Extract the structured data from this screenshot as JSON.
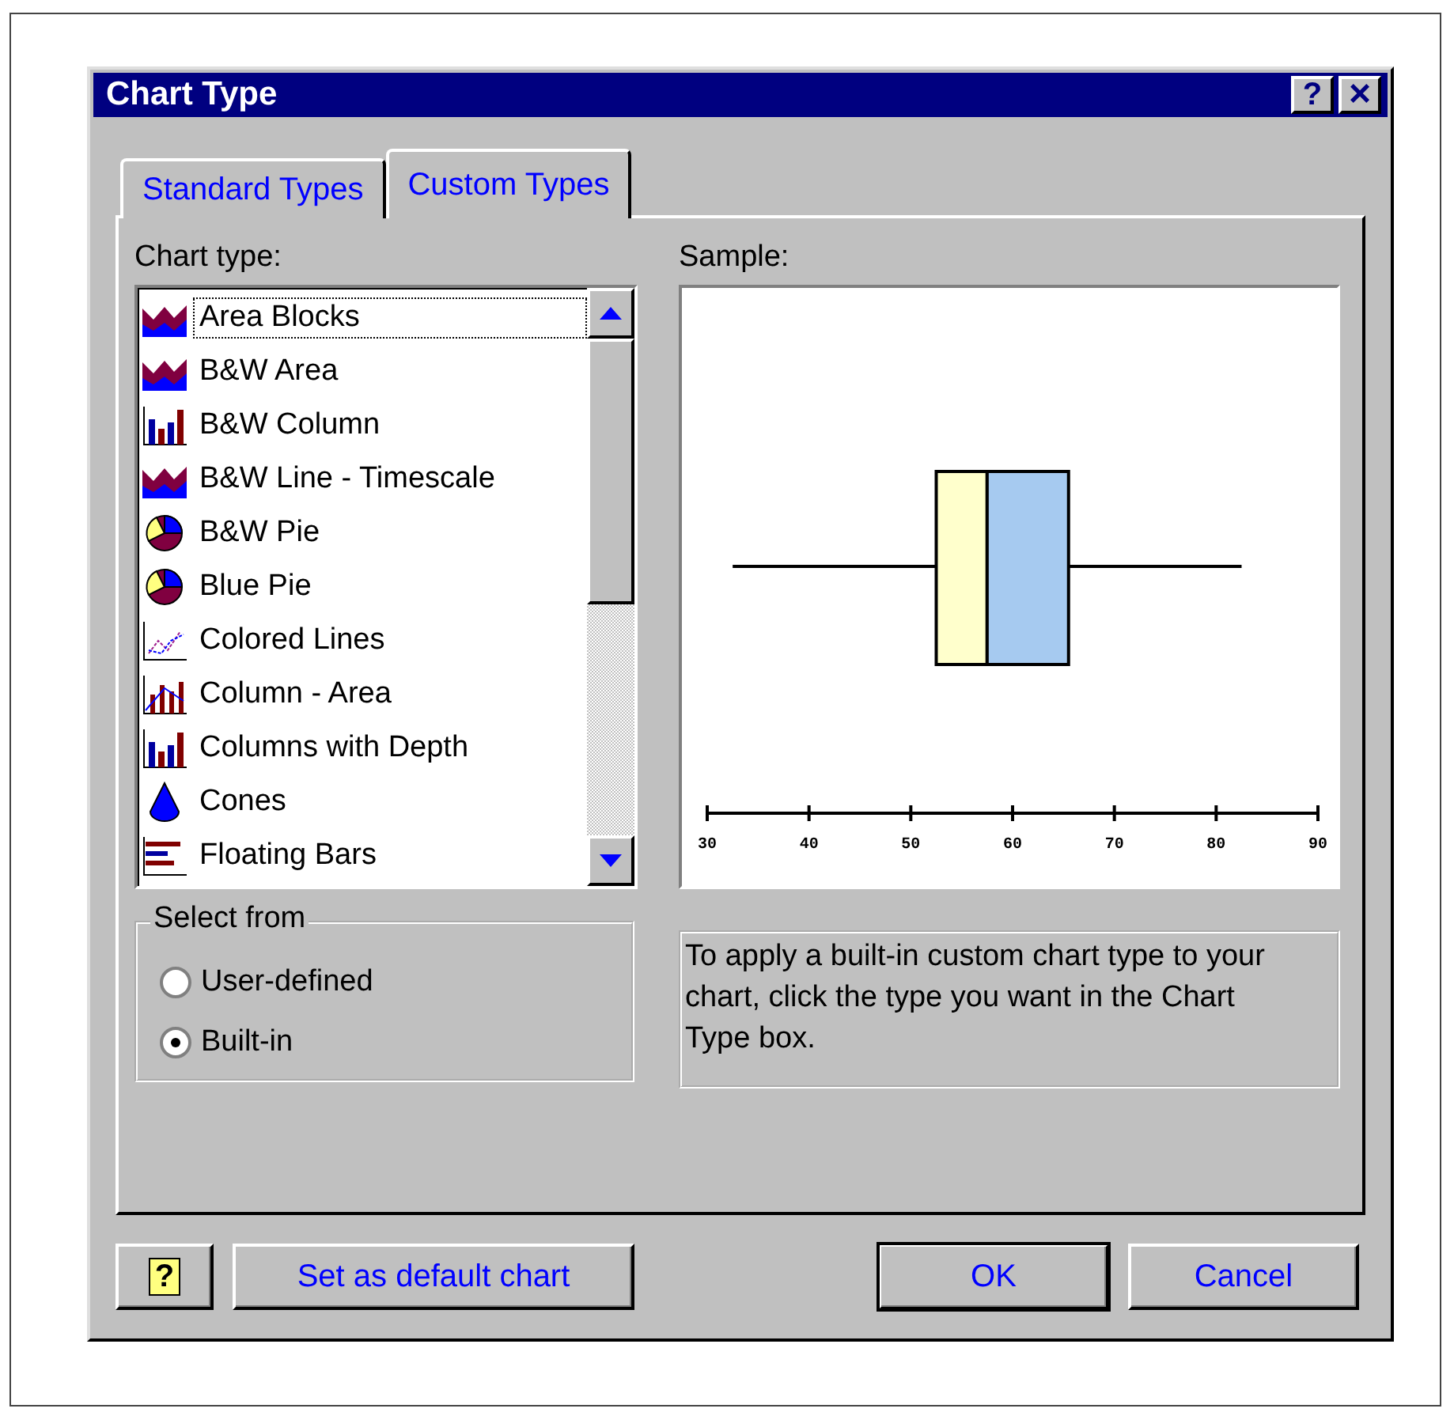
{
  "window": {
    "title": "Chart Type",
    "title_buttons": [
      {
        "kind": "help",
        "label": "?"
      },
      {
        "kind": "close",
        "label": "×"
      }
    ]
  },
  "tabs": [
    {
      "label": "Standard Types",
      "selected": false
    },
    {
      "label": "Custom Types",
      "selected": true
    }
  ],
  "chart_type_list": {
    "label": "Chart type:",
    "items": [
      {
        "label": "Area Blocks",
        "kind": "area",
        "selected": true
      },
      {
        "label": "B&W Area",
        "kind": "area",
        "selected": false
      },
      {
        "label": "B&W Column",
        "kind": "column",
        "selected": false
      },
      {
        "label": "B&W Line - Timescale",
        "kind": "area",
        "selected": false
      },
      {
        "label": "B&W Pie",
        "kind": "pie",
        "selected": false
      },
      {
        "label": "Blue Pie",
        "kind": "pie",
        "selected": false
      },
      {
        "label": "Colored Lines",
        "kind": "lines",
        "selected": false
      },
      {
        "label": "Column - Area",
        "kind": "column-area",
        "selected": false
      },
      {
        "label": "Columns with Depth",
        "kind": "column",
        "selected": false
      },
      {
        "label": "Cones",
        "kind": "cone",
        "selected": false
      },
      {
        "label": "Floating Bars",
        "kind": "floating-bars",
        "selected": false
      }
    ]
  },
  "sample": {
    "label": "Sample:",
    "axis_labels": [
      "30",
      "40",
      "50",
      "60",
      "70",
      "80",
      "90"
    ]
  },
  "select_from": {
    "label": "Select from",
    "options": [
      {
        "label": "User-defined",
        "selected": false
      },
      {
        "label": "Built-in",
        "selected": true
      }
    ]
  },
  "description": "To apply a built-in custom chart type to your chart, click the type you want in the Chart Type box.",
  "buttons": [
    {
      "kind": "help",
      "label": "?"
    },
    {
      "kind": "default",
      "label": "Set as default chart"
    },
    {
      "kind": "ok",
      "label": "OK"
    },
    {
      "kind": "cancel",
      "label": "Cancel"
    }
  ]
}
